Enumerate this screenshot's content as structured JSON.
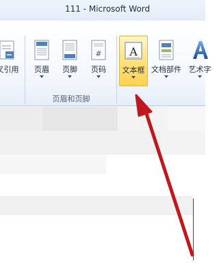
{
  "window": {
    "title": "111 - Microsoft Word"
  },
  "ribbon": {
    "buttons": {
      "citation": {
        "label": "叉引用",
        "icon": "cross-reference-icon"
      },
      "header": {
        "label": "页眉",
        "icon": "header-icon"
      },
      "footer": {
        "label": "页脚",
        "icon": "footer-icon"
      },
      "page_number": {
        "label": "页码",
        "icon": "page-number-icon"
      },
      "textbox": {
        "label": "文本框",
        "icon": "textbox-icon",
        "state": "hovered"
      },
      "quick_parts": {
        "label": "文档部件",
        "icon": "quick-parts-icon"
      },
      "wordart": {
        "label": "艺术字",
        "icon": "wordart-icon"
      }
    },
    "groups": {
      "header_footer": "页眉和页脚"
    }
  },
  "annotation": {
    "type": "arrow",
    "color": "#c0171d",
    "target": "textbox-button"
  }
}
